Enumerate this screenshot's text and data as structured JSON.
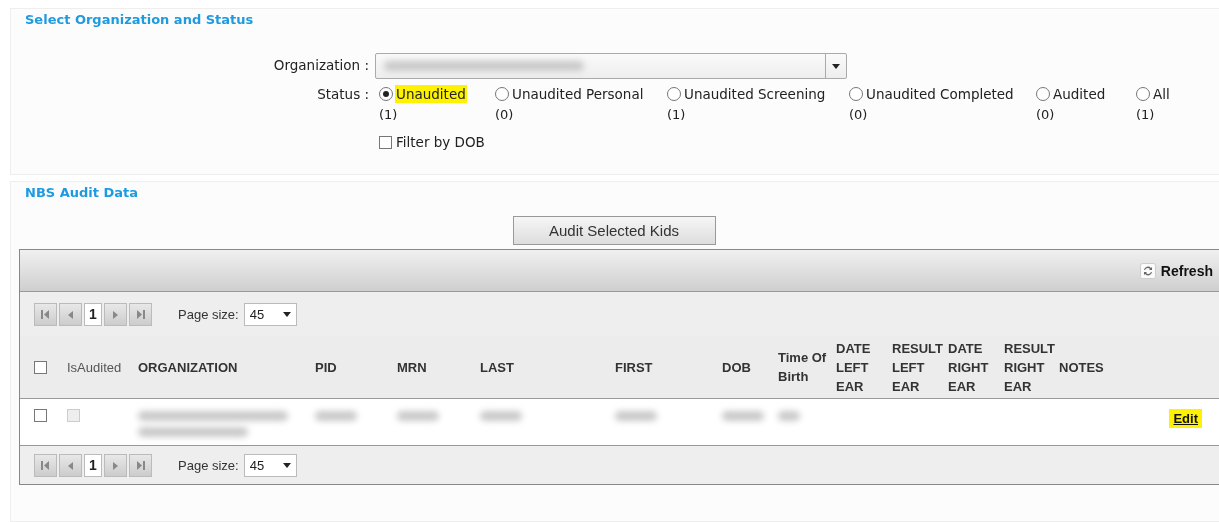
{
  "filter": {
    "legend": "Select Organization and Status",
    "organization": {
      "label": "Organization :",
      "kind": "redacted"
    },
    "status": {
      "label": "Status :",
      "options": [
        {
          "label": "Unaudited",
          "count": "(1)",
          "selected": true,
          "highlighted": true
        },
        {
          "label": "Unaudited Personal",
          "count": "(0)",
          "selected": false,
          "highlighted": false
        },
        {
          "label": "Unaudited Screening",
          "count": "(1)",
          "selected": false,
          "highlighted": false
        },
        {
          "label": "Unaudited Completed",
          "count": "(0)",
          "selected": false,
          "highlighted": false
        },
        {
          "label": "Audited",
          "count": "(0)",
          "selected": false,
          "highlighted": false
        },
        {
          "label": "All",
          "count": "(1)",
          "selected": false,
          "highlighted": false
        }
      ]
    },
    "filter_by_dob": {
      "label": "Filter by DOB",
      "checked": false
    }
  },
  "audit": {
    "legend": "NBS Audit Data",
    "audit_button": "Audit Selected Kids",
    "grid": {
      "refresh": "Refresh",
      "pager_top": {
        "page": "1",
        "page_size_label": "Page size:",
        "page_size": "45"
      },
      "columns": [
        {
          "kind": "checkbox",
          "checked": false
        },
        {
          "kind": "plain",
          "label": "IsAudited"
        },
        {
          "kind": "bold",
          "label": "ORGANIZATION"
        },
        {
          "kind": "bold",
          "label": "PID"
        },
        {
          "kind": "bold",
          "label": "MRN"
        },
        {
          "kind": "bold",
          "label": "LAST"
        },
        {
          "kind": "bold",
          "label": "FIRST"
        },
        {
          "kind": "bold",
          "label": "DOB"
        },
        {
          "kind": "bold",
          "label": "Time Of Birth"
        },
        {
          "kind": "bold",
          "label": "DATE LEFT EAR"
        },
        {
          "kind": "bold",
          "label": "RESULT LEFT EAR"
        },
        {
          "kind": "bold",
          "label": "DATE RIGHT EAR"
        },
        {
          "kind": "bold",
          "label": "RESULT RIGHT EAR"
        },
        {
          "kind": "bold",
          "label": "NOTES"
        }
      ],
      "rows": [
        {
          "selected": false,
          "is_audited": false,
          "cells": [
            {
              "kind": "redacted_long"
            },
            {
              "kind": "redacted"
            },
            {
              "kind": "redacted"
            },
            {
              "kind": "redacted"
            },
            {
              "kind": "redacted"
            },
            {
              "kind": "redacted"
            },
            {
              "kind": "redacted_short"
            }
          ],
          "edit": {
            "label": "Edit",
            "highlighted": true
          }
        }
      ],
      "pager_bottom": {
        "page": "1",
        "page_size_label": "Page size:",
        "page_size": "45"
      }
    }
  }
}
